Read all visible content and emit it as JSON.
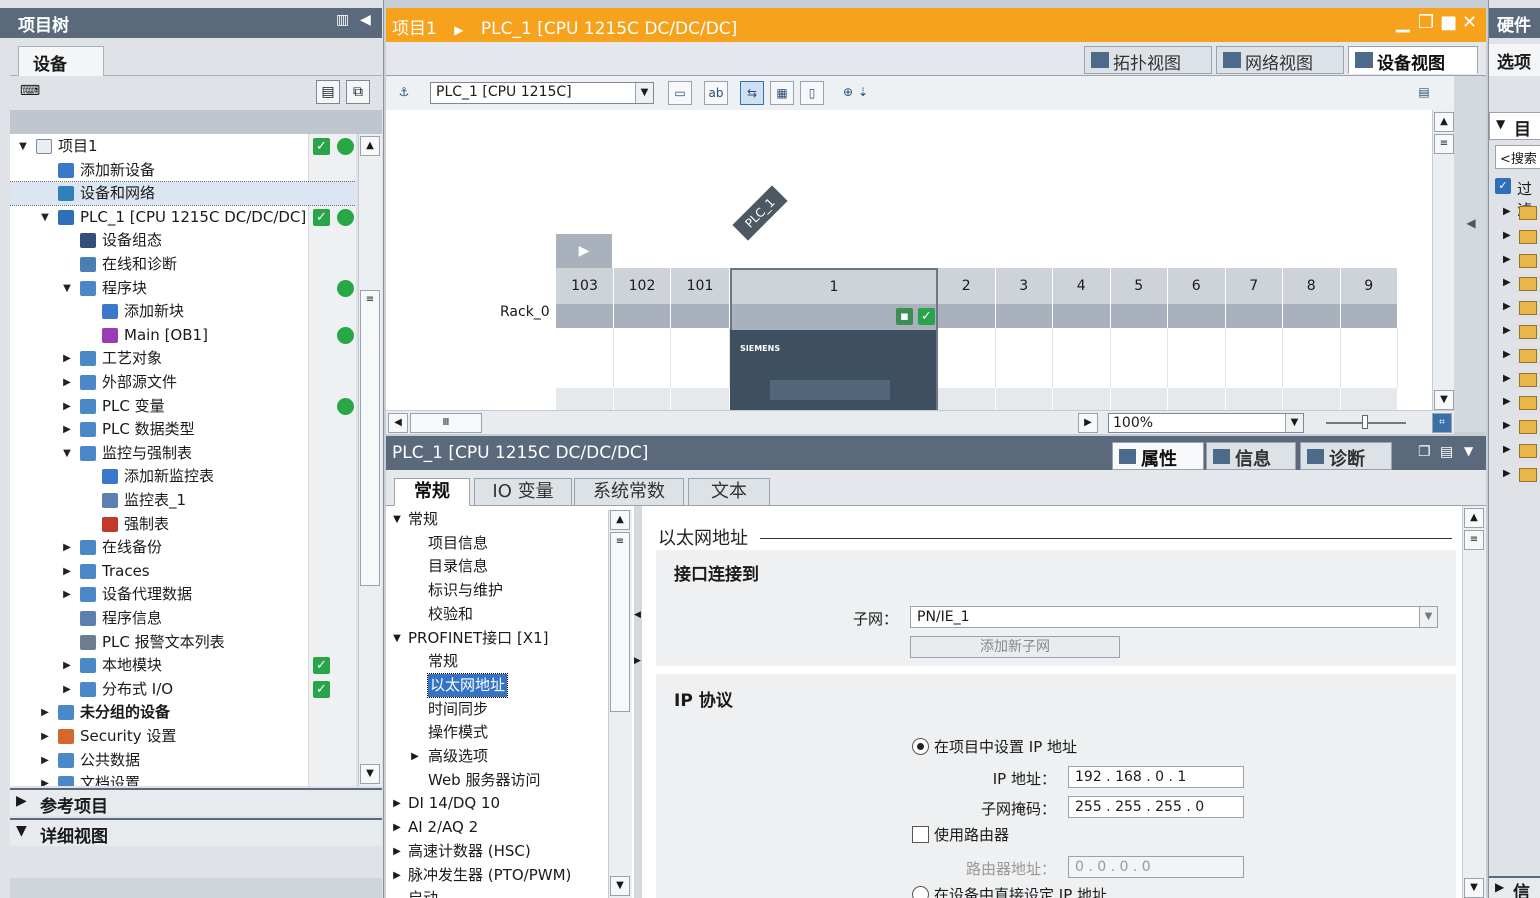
{
  "project_tree": {
    "title": "项目树",
    "tab": "设备",
    "items": [
      {
        "label": "项目1",
        "level": 0,
        "arrow": "▼",
        "icon": "project-icon",
        "check": true,
        "dot": true
      },
      {
        "label": "添加新设备",
        "level": 1,
        "arrow": "",
        "icon": "add-device-icon"
      },
      {
        "label": "设备和网络",
        "level": 1,
        "arrow": "",
        "icon": "network-icon",
        "selected": true
      },
      {
        "label": "PLC_1 [CPU 1215C DC/DC/DC]",
        "level": 1,
        "arrow": "▼",
        "icon": "plc-icon",
        "check": true,
        "dot": true
      },
      {
        "label": "设备组态",
        "level": 2,
        "arrow": "",
        "icon": "device-config-icon"
      },
      {
        "label": "在线和诊断",
        "level": 2,
        "arrow": "",
        "icon": "diagnostics-icon"
      },
      {
        "label": "程序块",
        "level": 2,
        "arrow": "▼",
        "icon": "folder-icon",
        "dot": true
      },
      {
        "label": "添加新块",
        "level": 3,
        "arrow": "",
        "icon": "add-block-icon"
      },
      {
        "label": "Main [OB1]",
        "level": 3,
        "arrow": "",
        "icon": "ob-block-icon",
        "dot": true
      },
      {
        "label": "工艺对象",
        "level": 2,
        "arrow": "▶",
        "icon": "folder-icon"
      },
      {
        "label": "外部源文件",
        "level": 2,
        "arrow": "▶",
        "icon": "folder-icon"
      },
      {
        "label": "PLC 变量",
        "level": 2,
        "arrow": "▶",
        "icon": "folder-icon",
        "dot": true
      },
      {
        "label": "PLC 数据类型",
        "level": 2,
        "arrow": "▶",
        "icon": "folder-icon"
      },
      {
        "label": "监控与强制表",
        "level": 2,
        "arrow": "▼",
        "icon": "folder-icon"
      },
      {
        "label": "添加新监控表",
        "level": 3,
        "arrow": "",
        "icon": "add-table-icon"
      },
      {
        "label": "监控表_1",
        "level": 3,
        "arrow": "",
        "icon": "watch-table-icon"
      },
      {
        "label": "强制表",
        "level": 3,
        "arrow": "",
        "icon": "force-table-icon"
      },
      {
        "label": "在线备份",
        "level": 2,
        "arrow": "▶",
        "icon": "folder-icon"
      },
      {
        "label": "Traces",
        "level": 2,
        "arrow": "▶",
        "icon": "folder-icon"
      },
      {
        "label": "设备代理数据",
        "level": 2,
        "arrow": "▶",
        "icon": "folder-icon"
      },
      {
        "label": "程序信息",
        "level": 2,
        "arrow": "",
        "icon": "program-info-icon"
      },
      {
        "label": "PLC 报警文本列表",
        "level": 2,
        "arrow": "",
        "icon": "alarm-list-icon"
      },
      {
        "label": "本地模块",
        "level": 2,
        "arrow": "▶",
        "icon": "folder-icon",
        "check": true
      },
      {
        "label": "分布式 I/O",
        "level": 2,
        "arrow": "▶",
        "icon": "folder-icon",
        "check": true
      },
      {
        "label": "未分组的设备",
        "level": 1,
        "arrow": "▶",
        "icon": "folder-icon",
        "bold": true
      },
      {
        "label": "Security 设置",
        "level": 1,
        "arrow": "▶",
        "icon": "security-icon"
      },
      {
        "label": "公共数据",
        "level": 1,
        "arrow": "▶",
        "icon": "folder-icon"
      },
      {
        "label": "文档设置",
        "level": 1,
        "arrow": "▶",
        "icon": "folder-icon"
      }
    ],
    "ref_projects": "参考项目",
    "detail_view": "详细视图"
  },
  "editor": {
    "breadcrumb": [
      "项目1",
      "PLC_1 [CPU 1215C DC/DC/DC]"
    ],
    "views": [
      "拓扑视图",
      "网络视图",
      "设备视图"
    ],
    "active_view": "设备视图",
    "device_select": "PLC_1 [CPU 1215C]",
    "plc_tag": "PLC_1",
    "rack_name": "Rack_0",
    "slots_left": [
      "103",
      "102",
      "101"
    ],
    "slot_main": "1",
    "slots_right": [
      "2",
      "3",
      "4",
      "5",
      "6",
      "7",
      "8",
      "9"
    ],
    "cpu_brand": "SIEMENS",
    "zoom": "100%"
  },
  "properties": {
    "title": "PLC_1 [CPU 1215C DC/DC/DC]",
    "tabs": [
      "属性",
      "信息",
      "诊断"
    ],
    "active_tab": "属性",
    "subtabs": [
      "常规",
      "IO 变量",
      "系统常数",
      "文本"
    ],
    "nav": [
      {
        "label": "常规",
        "indent": 0,
        "arrow": "▼"
      },
      {
        "label": "项目信息",
        "indent": 1,
        "arrow": ""
      },
      {
        "label": "目录信息",
        "indent": 1,
        "arrow": ""
      },
      {
        "label": "标识与维护",
        "indent": 1,
        "arrow": ""
      },
      {
        "label": "校验和",
        "indent": 1,
        "arrow": ""
      },
      {
        "label": "PROFINET接口 [X1]",
        "indent": 0,
        "arrow": "▼"
      },
      {
        "label": "常规",
        "indent": 1,
        "arrow": ""
      },
      {
        "label": "以太网地址",
        "indent": 1,
        "arrow": "",
        "selected": true
      },
      {
        "label": "时间同步",
        "indent": 1,
        "arrow": ""
      },
      {
        "label": "操作模式",
        "indent": 1,
        "arrow": ""
      },
      {
        "label": "高级选项",
        "indent": 1,
        "arrow": "▶"
      },
      {
        "label": "Web 服务器访问",
        "indent": 1,
        "arrow": ""
      },
      {
        "label": "DI 14/DQ 10",
        "indent": 0,
        "arrow": "▶"
      },
      {
        "label": "AI 2/AQ 2",
        "indent": 0,
        "arrow": "▶"
      },
      {
        "label": "高速计数器 (HSC)",
        "indent": 0,
        "arrow": "▶"
      },
      {
        "label": "脉冲发生器 (PTO/PWM)",
        "indent": 0,
        "arrow": "▶"
      },
      {
        "label": "启动",
        "indent": 0,
        "arrow": ""
      }
    ],
    "section_title": "以太网地址",
    "interface": {
      "heading": "接口连接到",
      "subnet_label": "子网：",
      "subnet_value": "PN/IE_1",
      "add_subnet": "添加新子网"
    },
    "ip": {
      "heading": "IP 协议",
      "opt_project": "在项目中设置 IP 地址",
      "ip_label": "IP 地址：",
      "ip_value": "192 . 168 .  0   .  1",
      "mask_label": "子网掩码：",
      "mask_value": "255 . 255 . 255 .  0",
      "router_check": "使用路由器",
      "router_label": "路由器地址：",
      "router_value": " 0   .  0   .  0   .  0",
      "opt_device": "在设备中直接设定 IP 地址"
    }
  },
  "catalog": {
    "title": "硬件",
    "options": "选项",
    "list_head": "目",
    "search": "<搜索",
    "filter": "过滤"
  }
}
